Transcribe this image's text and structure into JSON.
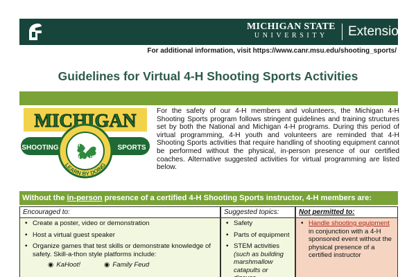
{
  "header": {
    "msu_name": "MICHIGAN STATE",
    "msu_university": "UNIVERSITY",
    "extension": "Extension",
    "bar_color": "#18453b"
  },
  "info_line": "For additional information, visit https://www.canr.msu.edu/shooting_sports/",
  "title": "Guidelines for Virtual 4-H Shooting Sports Activities",
  "logo": {
    "top_word": "MICHIGAN",
    "left_word": "SHOOTING",
    "right_word": "SPORTS",
    "bottom_word": "LEARN BY DOING"
  },
  "intro": "For the safety of our 4-H members and volunteers, the Michigan 4-H Shooting Sports program follows stringent guidelines and training structures set by both the National and Michigan 4-H programs.  During this period of virtual programming, 4-H youth and volunteers are reminded that 4-H Shooting Sports activities that require handling of shooting equipment cannot be performed without the physical, in-person presence of our certified coaches. Alternative suggested activities for virtual programming are listed below.",
  "banner": {
    "before": "Without the ",
    "underlined": "in-person",
    "after": " presence of a certified 4-H Shooting Sports instructor, 4-H members are:"
  },
  "table": {
    "col1_header": "Encouraged to:",
    "col2_header": "Suggested topics:",
    "col3_header": "Not permitted to:",
    "encouraged": [
      "Create a poster, video or demonstration",
      "Host a virtual guest speaker",
      "Organize games that test skills or demonstrate knowledge of safety. Skill-a-thon style platforms include:"
    ],
    "platforms": [
      "KaHoot!",
      "Family Feud"
    ],
    "topics": [
      "Safety",
      "Parts of equipment",
      "STEM activities"
    ],
    "topic_detail": "(such as building marshmallow catapults or discuss",
    "not_permitted_underlined": "Handle shooting equipment",
    "not_permitted_rest": " in conjunction with a 4-H sponsored event without the physical presence of a certified instructor"
  },
  "colors": {
    "accent_green": "#7aa337",
    "title_green": "#2d5b49",
    "light_green_fill": "#f2f7df",
    "peach_fill": "#f5d5c2"
  }
}
